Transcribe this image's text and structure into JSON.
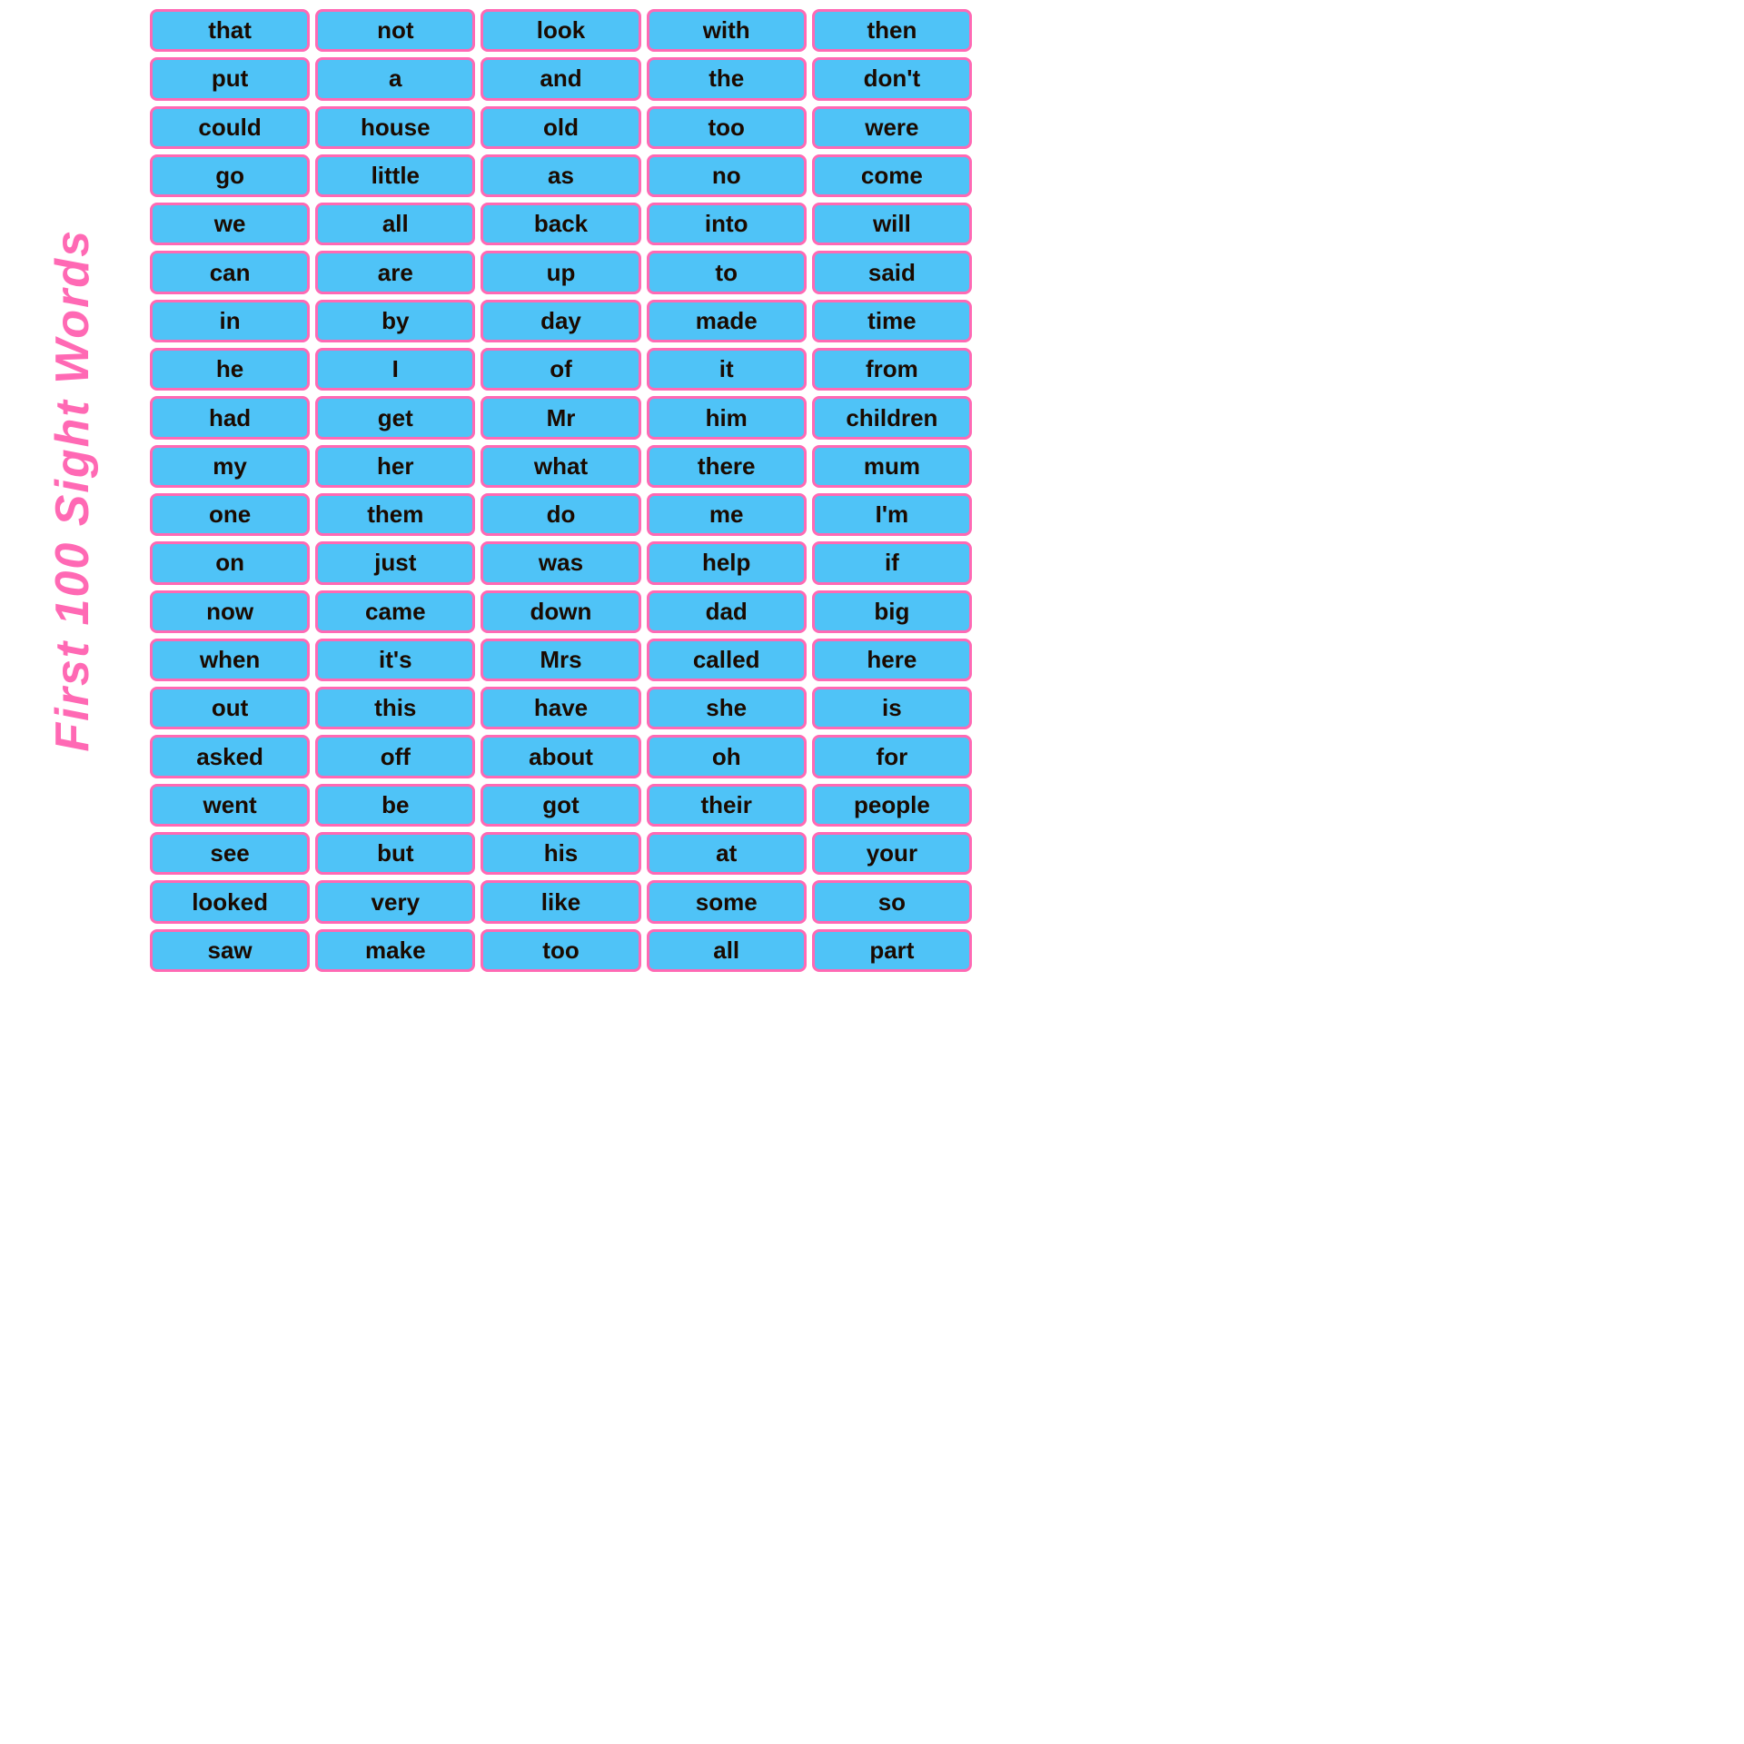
{
  "sidebar": {
    "title": "First 100 Sight Words"
  },
  "words": [
    "that",
    "not",
    "look",
    "with",
    "then",
    "put",
    "a",
    "and",
    "the",
    "don't",
    "could",
    "house",
    "old",
    "too",
    "were",
    "go",
    "little",
    "as",
    "no",
    "come",
    "we",
    "all",
    "back",
    "into",
    "will",
    "can",
    "are",
    "up",
    "to",
    "said",
    "in",
    "by",
    "day",
    "made",
    "time",
    "he",
    "I",
    "of",
    "it",
    "from",
    "had",
    "get",
    "Mr",
    "him",
    "children",
    "my",
    "her",
    "what",
    "there",
    "mum",
    "one",
    "them",
    "do",
    "me",
    "I'm",
    "on",
    "just",
    "was",
    "help",
    "if",
    "now",
    "came",
    "down",
    "dad",
    "big",
    "when",
    "it's",
    "Mrs",
    "called",
    "here",
    "out",
    "this",
    "have",
    "she",
    "is",
    "asked",
    "off",
    "about",
    "oh",
    "for",
    "went",
    "be",
    "got",
    "their",
    "people",
    "see",
    "but",
    "his",
    "at",
    "your",
    "looked",
    "very",
    "like",
    "some",
    "so",
    "saw",
    "make",
    "too",
    "all",
    "part"
  ]
}
